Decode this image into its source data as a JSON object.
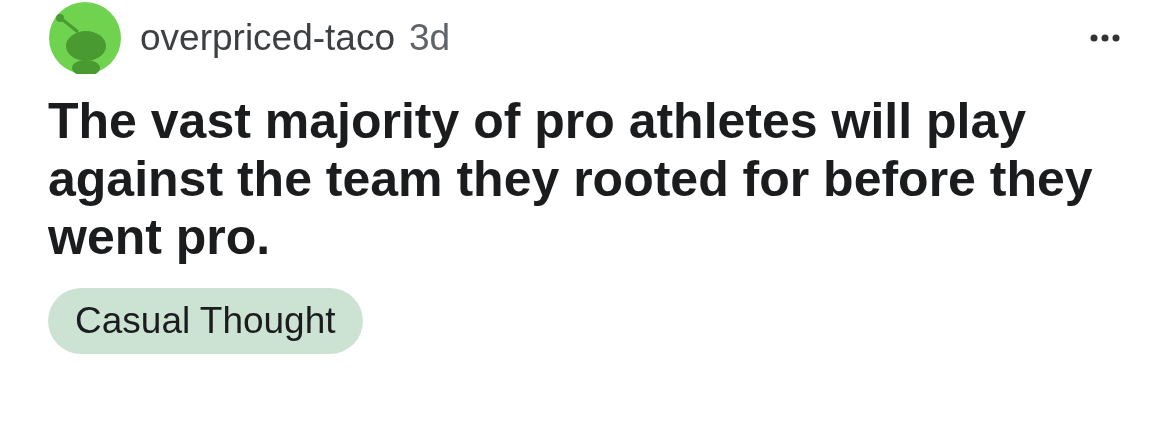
{
  "post": {
    "author": "overpriced-taco",
    "age": "3d",
    "title": "The vast majority of pro athletes will play against the team they rooted for before they went pro.",
    "flair": {
      "label": "Casual Thought",
      "color": "#cce3d3"
    }
  }
}
